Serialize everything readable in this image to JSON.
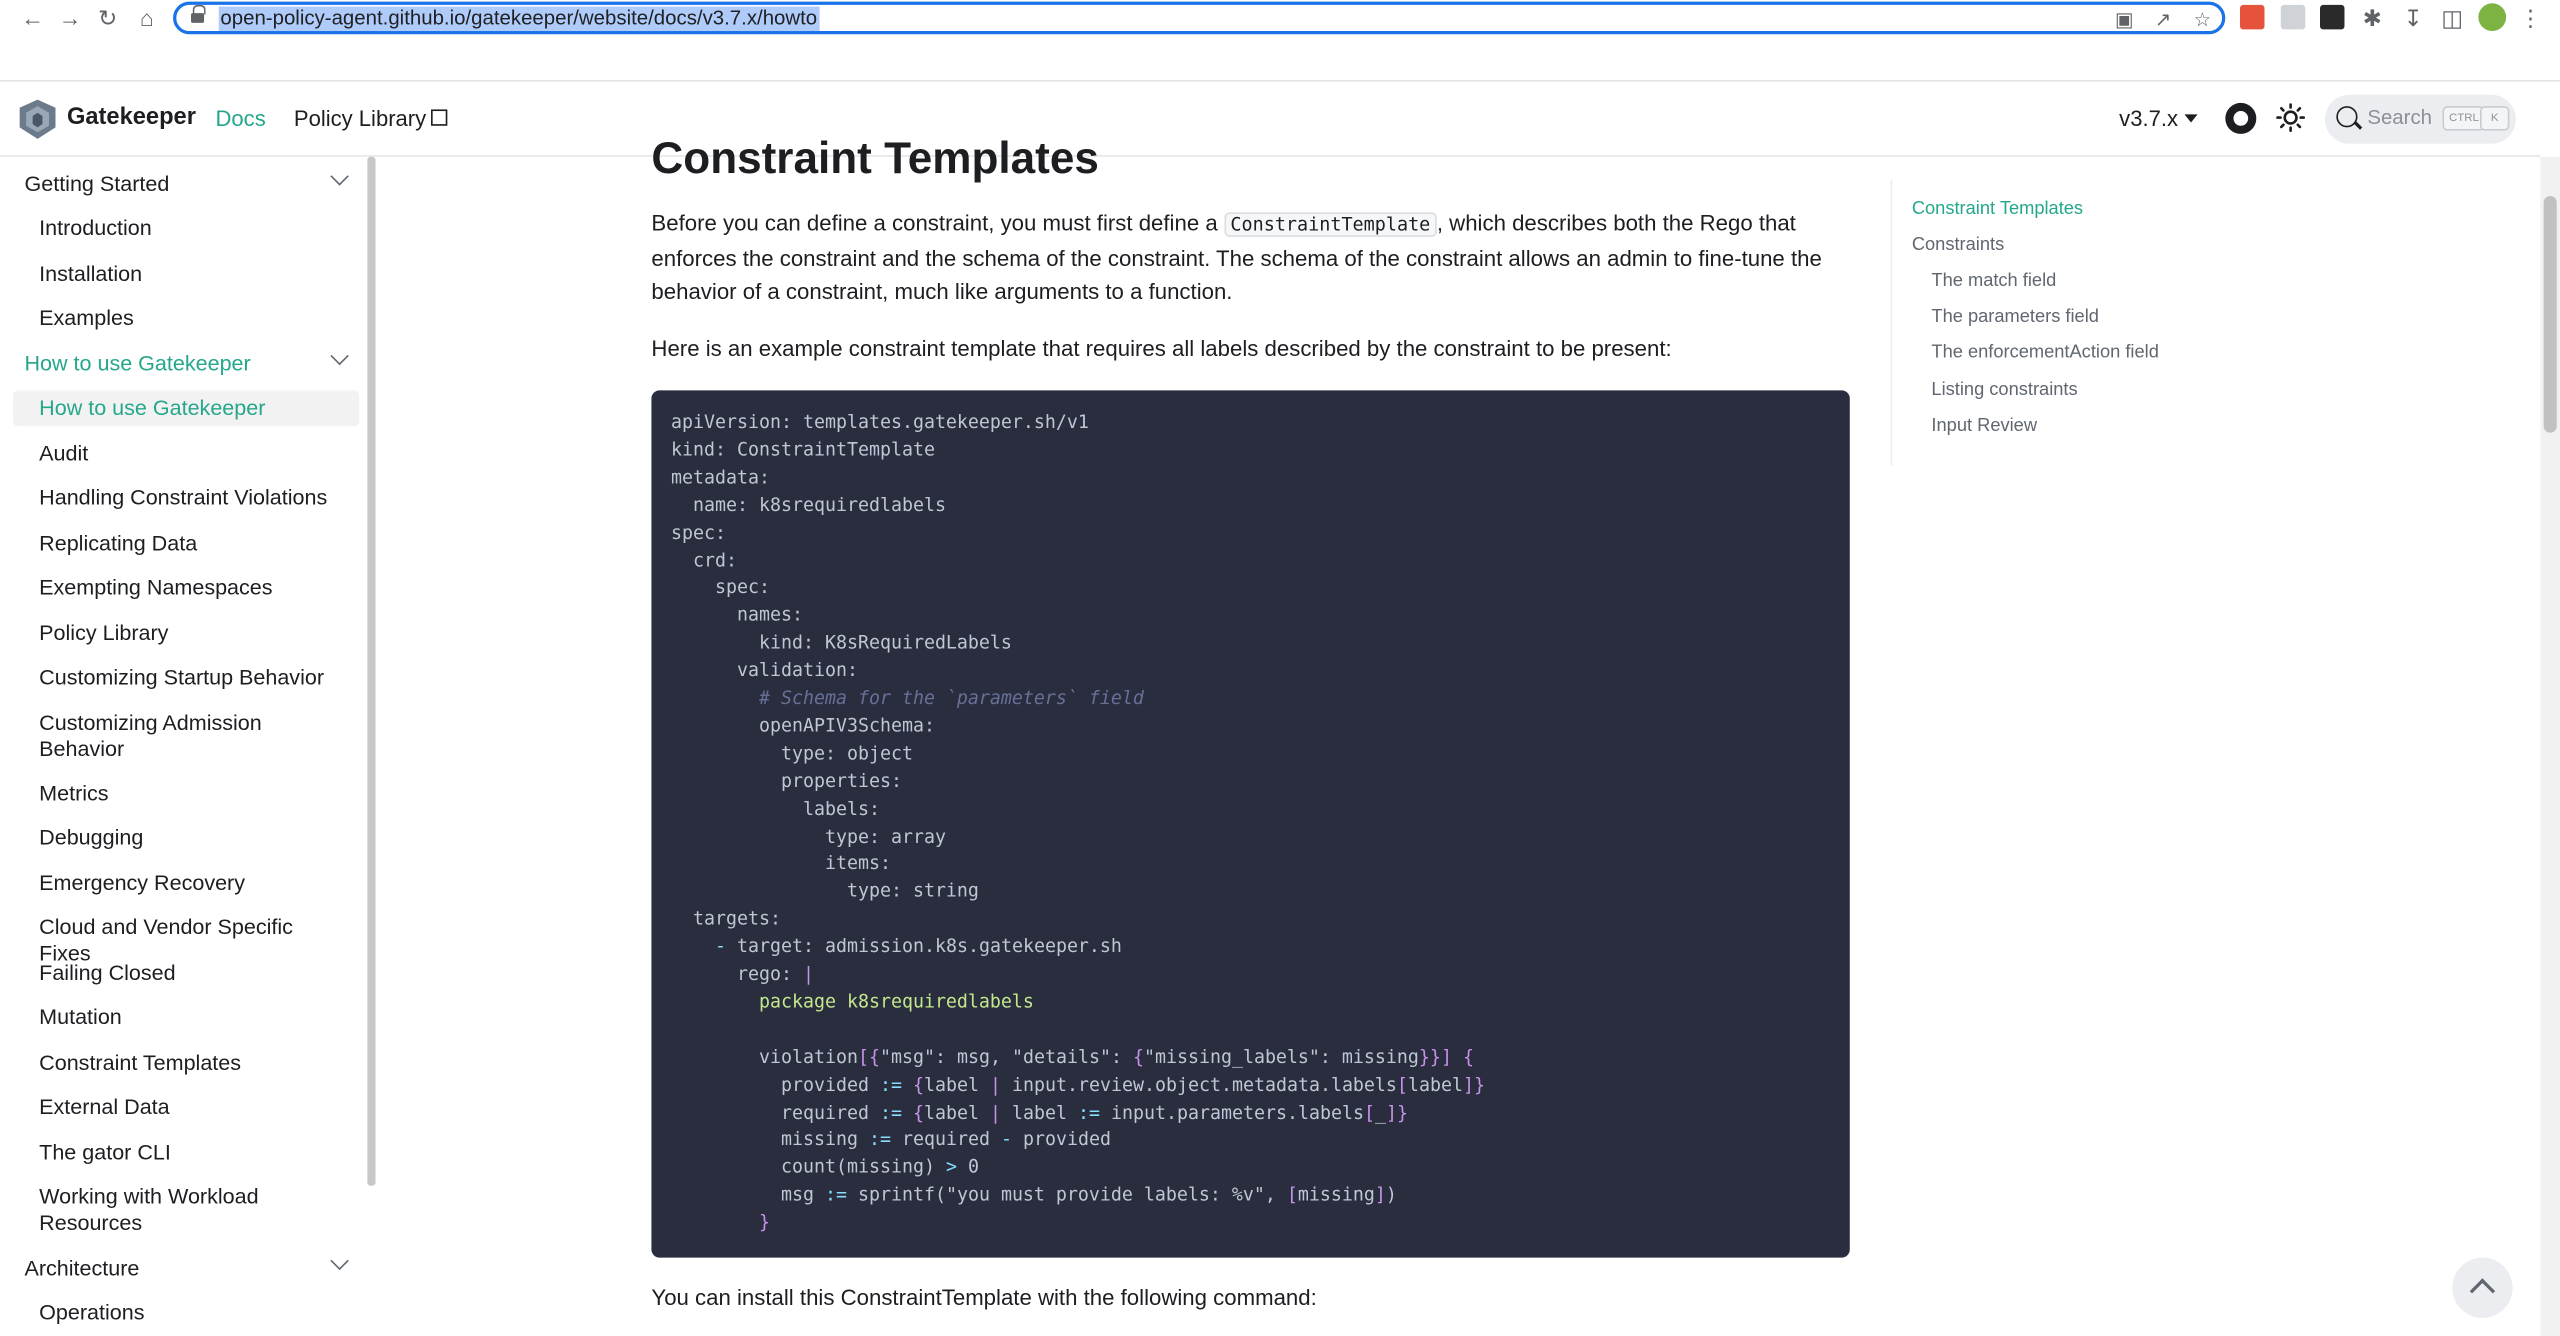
{
  "browser": {
    "url": "open-policy-agent.github.io/gatekeeper/website/docs/v3.7.x/howto"
  },
  "navbar": {
    "brand": "Gatekeeper",
    "docs": "Docs",
    "policy_library": "Policy Library",
    "version": "v3.7.x",
    "search_placeholder": "Search",
    "kbd_ctrl": "CTRL",
    "kbd_k": "K"
  },
  "sidebar": {
    "items": [
      {
        "label": "Getting Started",
        "type": "category"
      },
      {
        "label": "Introduction"
      },
      {
        "label": "Installation"
      },
      {
        "label": "Examples"
      },
      {
        "label": "How to use Gatekeeper",
        "type": "category",
        "active": true
      },
      {
        "label": "How to use Gatekeeper",
        "active": true
      },
      {
        "label": "Audit"
      },
      {
        "label": "Handling Constraint Violations"
      },
      {
        "label": "Replicating Data"
      },
      {
        "label": "Exempting Namespaces"
      },
      {
        "label": "Policy Library"
      },
      {
        "label": "Customizing Startup Behavior"
      },
      {
        "label": "Customizing Admission Behavior"
      },
      {
        "label": "Metrics"
      },
      {
        "label": "Debugging"
      },
      {
        "label": "Emergency Recovery"
      },
      {
        "label": "Cloud and Vendor Specific Fixes"
      },
      {
        "label": "Failing Closed"
      },
      {
        "label": "Mutation"
      },
      {
        "label": "Constraint Templates"
      },
      {
        "label": "External Data"
      },
      {
        "label": "The gator CLI"
      },
      {
        "label": "Working with Workload Resources"
      },
      {
        "label": "Architecture",
        "type": "category"
      },
      {
        "label": "Operations"
      }
    ]
  },
  "main": {
    "heading": "Constraint Templates",
    "intro_1": "Before you can define a constraint, you must first define a ",
    "intro_code": "ConstraintTemplate",
    "intro_2": ", which describes both the Rego that enforces the constraint and the schema of the constraint. The schema of the constraint allows an admin to fine-tune the behavior of a constraint, much like arguments to a function.",
    "example_intro": "Here is an example constraint template that requires all labels described by the constraint to be present:",
    "install_text": "You can install this ConstraintTemplate with the following command:"
  },
  "code_lines": [
    "apiVersion: templates.gatekeeper.sh/v1",
    "kind: ConstraintTemplate",
    "metadata:",
    "  name: k8srequiredlabels",
    "spec:",
    "  crd:",
    "    spec:",
    "      names:",
    "        kind: K8sRequiredLabels",
    "      validation:",
    "        # Schema for the `parameters` field",
    "        openAPIV3Schema:",
    "          type: object",
    "          properties:",
    "            labels:",
    "              type: array",
    "              items:",
    "                type: string",
    "  targets:",
    "    - target: admission.k8s.gatekeeper.sh",
    "      rego: |",
    "        package k8srequiredlabels",
    "",
    "        violation[{\"msg\": msg, \"details\": {\"missing_labels\": missing}}] {",
    "          provided := {label | input.review.object.metadata.labels[label]}",
    "          required := {label | label := input.parameters.labels[_]}",
    "          missing := required - provided",
    "          count(missing) > 0",
    "          msg := sprintf(\"you must provide labels: %v\", [missing])",
    "        }"
  ],
  "toc": [
    {
      "label": "Constraint Templates",
      "active": true,
      "level": 1
    },
    {
      "label": "Constraints",
      "level": 1
    },
    {
      "label": "The match field",
      "level": 2
    },
    {
      "label": "The parameters field",
      "level": 2
    },
    {
      "label": "The enforcementAction field",
      "level": 2
    },
    {
      "label": "Listing constraints",
      "level": 2
    },
    {
      "label": "Input Review",
      "level": 2
    }
  ],
  "colors": {
    "accent": "#25a78c",
    "code_bg": "#292d3e"
  }
}
